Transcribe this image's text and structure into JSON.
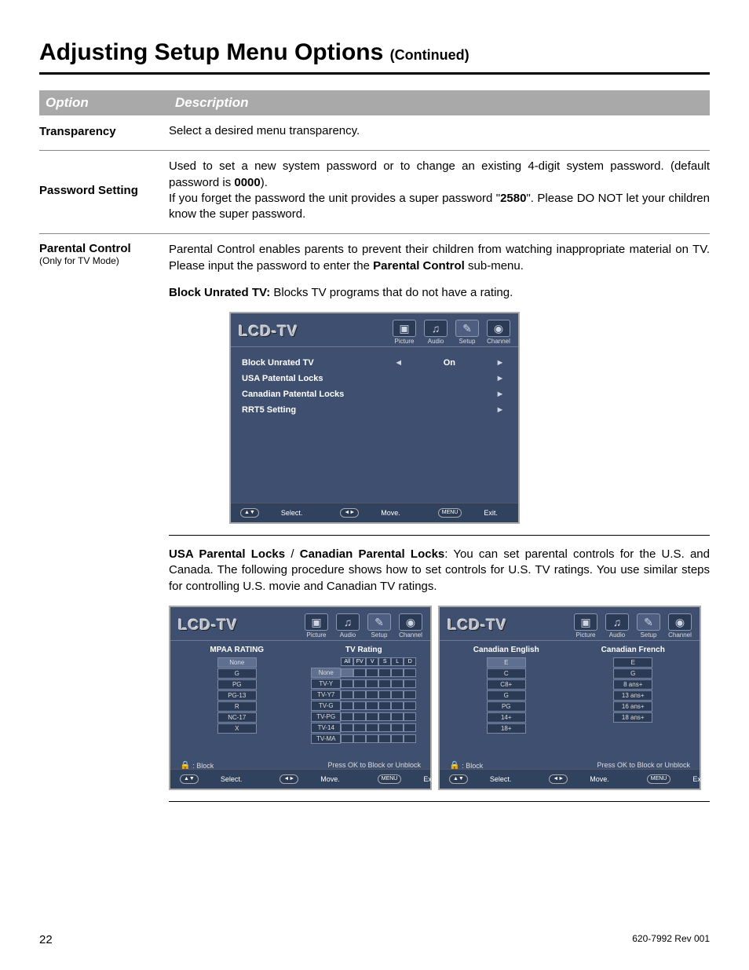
{
  "page": {
    "title": "Adjusting Setup Menu Options",
    "continued": "(Continued)",
    "number": "22",
    "rev": "620-7992 Rev 001"
  },
  "table_header": {
    "col1": "Option",
    "col2": "Description"
  },
  "options": {
    "transparency": {
      "name": "Transparency",
      "desc": "Select a desired menu transparency."
    },
    "password": {
      "name": "Password Setting",
      "line1": "Used to set a new system password or to change an existing 4-digit system password. (default password is ",
      "default_pw": "0000",
      "line1_end": ").",
      "line2a": "If you forget the password the unit provides a super password \"",
      "super_pw": "2580",
      "line2b": "\".  Please DO NOT let your children know the super password."
    },
    "parental": {
      "name": "Parental Control",
      "sub": "(Only for TV Mode)",
      "desc_a": "Parental Control enables parents to prevent their children from watching inappropriate material on TV. Please input the password to enter the ",
      "desc_bold": "Parental Control",
      "desc_b": " sub-menu."
    }
  },
  "block_unrated": {
    "label": "Block Unrated TV:",
    "text": " Blocks TV programs that do not have a rating."
  },
  "usa_locks": {
    "bold1": "USA Parental Locks",
    "sep": " / ",
    "bold2": "Canadian Parental Locks",
    "text": ": You can set parental controls for the U.S. and Canada. The following procedure shows how to set controls for U.S. TV ratings. You use similar steps for controlling U.S. movie and Canadian TV ratings."
  },
  "tv": {
    "logo": "LCD-TV",
    "tabs": {
      "picture": "Picture",
      "audio": "Audio",
      "setup": "Setup",
      "channel": "Channel"
    },
    "menu1": {
      "item1": {
        "label": "Block Unrated TV",
        "val": "On"
      },
      "item2": "USA Patental Locks",
      "item3": "Canadian Patental Locks",
      "item4": "RRT5 Setting"
    },
    "footer": {
      "select": "Select.",
      "move": "Move.",
      "exit": "Exit.",
      "menu_btn": "MENU",
      "updown": "▲▼",
      "leftright": "◄►"
    },
    "usa_menu": {
      "mpaa_title": "MPAA RATING",
      "mpaa": [
        "None",
        "G",
        "PG",
        "PG-13",
        "R",
        "NC-17",
        "X"
      ],
      "tv_title": "TV Rating",
      "tv_cols": [
        "All",
        "FV",
        "V",
        "S",
        "L",
        "D"
      ],
      "tv_rows": [
        "None",
        "TV-Y",
        "TV-Y7",
        "TV-G",
        "TV-PG",
        "TV-14",
        "TV-MA"
      ],
      "block_label": ": Block",
      "ok_label": "Press OK to Block or Unblock"
    },
    "can_menu": {
      "eng_title": "Canadian English",
      "eng": [
        "E",
        "C",
        "C8+",
        "G",
        "PG",
        "14+",
        "18+"
      ],
      "fr_title": "Canadian French",
      "fr": [
        "E",
        "G",
        "8 ans+",
        "13 ans+",
        "16 ans+",
        "18 ans+"
      ],
      "block_label": ": Block",
      "ok_label": "Press OK to Block or Unblock"
    }
  }
}
